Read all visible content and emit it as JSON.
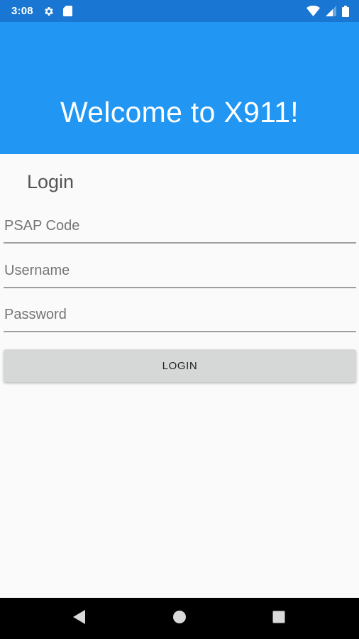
{
  "status_bar": {
    "time": "3:08",
    "left_icons": [
      "settings-gear-icon",
      "sd-card-icon"
    ],
    "right_icons": [
      "wifi-icon",
      "cell-signal-icon",
      "battery-icon"
    ]
  },
  "header": {
    "title": "Welcome to X911!",
    "background_color": "#2196f3",
    "status_bar_color": "#1976d2"
  },
  "login": {
    "heading": "Login",
    "fields": {
      "psap_code": {
        "placeholder": "PSAP Code",
        "value": ""
      },
      "username": {
        "placeholder": "Username",
        "value": ""
      },
      "password": {
        "placeholder": "Password",
        "value": ""
      }
    },
    "button_label": "LOGIN"
  },
  "nav_bar": {
    "icons": [
      "back-icon",
      "home-icon",
      "recents-icon"
    ]
  }
}
